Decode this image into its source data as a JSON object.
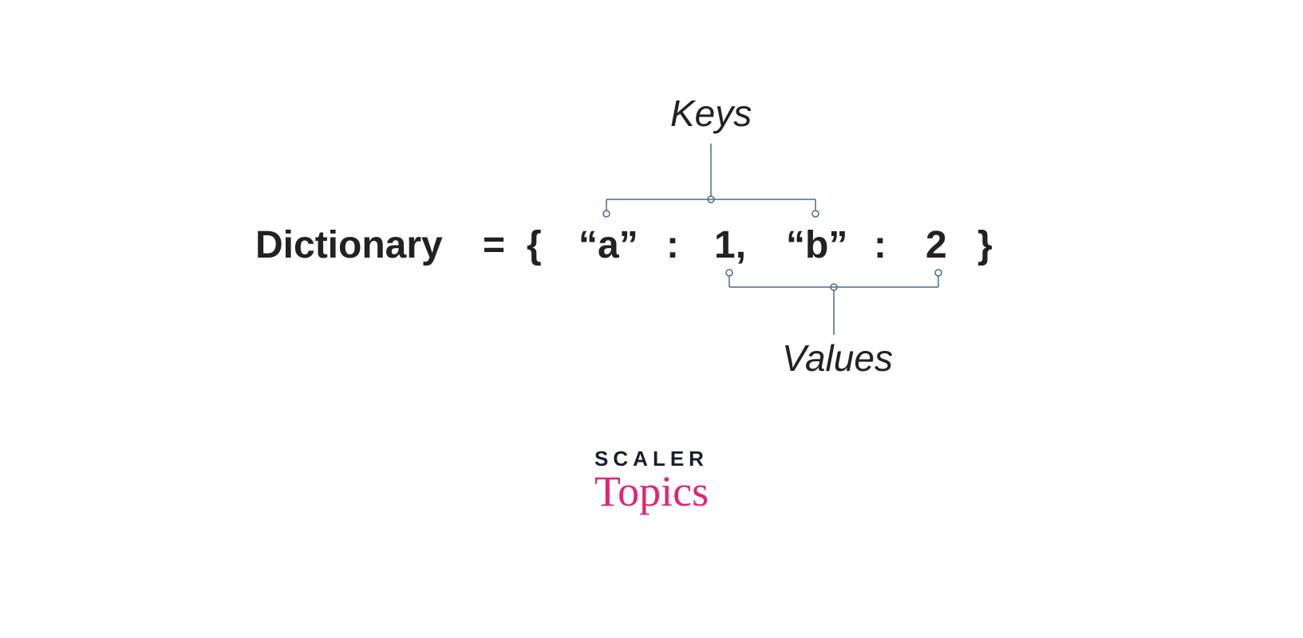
{
  "labels": {
    "keys": "Keys",
    "values": "Values"
  },
  "tokens": {
    "var": "Dictionary",
    "eq": "=",
    "open": "{",
    "key1": "“a”",
    "colon1": ":",
    "val1": "1,",
    "key2": "“b”",
    "colon2": ":",
    "val2": "2",
    "close": "}"
  },
  "brand": {
    "top": "SCALER",
    "bottom": "Topics"
  },
  "diagram": {
    "description": "Annotated Python-style dictionary literal showing which parts are keys and which are values.",
    "dictionary": {
      "a": 1,
      "b": 2
    },
    "keys_line_color": "#4a6a8f",
    "values_line_color": "#4a6a8f"
  }
}
